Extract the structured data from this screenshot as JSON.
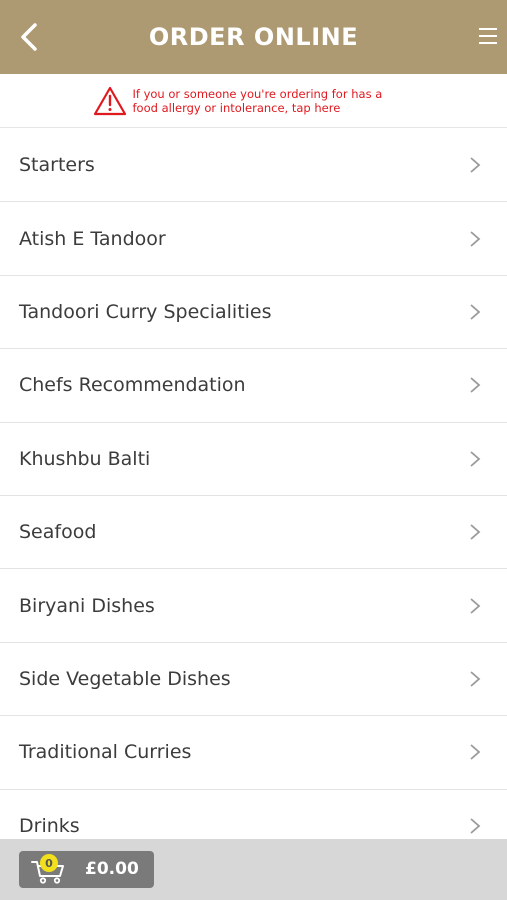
{
  "header": {
    "title": "ORDER ONLINE",
    "back_icon": "chevron-left-icon",
    "menu_icon": "hamburger-menu-icon",
    "background_color": "#ad9a72"
  },
  "allergy_notice": {
    "icon": "warning-triangle-icon",
    "text": "If you or someone you're ordering for has a food allergy or intolerance, tap here",
    "color": "#e0191f"
  },
  "menu": {
    "items": [
      {
        "label": "Starters"
      },
      {
        "label": "Atish E Tandoor"
      },
      {
        "label": "Tandoori Curry Specialities"
      },
      {
        "label": "Chefs Recommendation"
      },
      {
        "label": "Khushbu Balti"
      },
      {
        "label": "Seafood"
      },
      {
        "label": "Biryani Dishes"
      },
      {
        "label": "Side Vegetable Dishes"
      },
      {
        "label": "Traditional Curries"
      },
      {
        "label": "Drinks"
      }
    ]
  },
  "cart": {
    "icon": "shopping-cart-icon",
    "count": "0",
    "total": "£0.00",
    "badge_color": "#f2e01c"
  }
}
